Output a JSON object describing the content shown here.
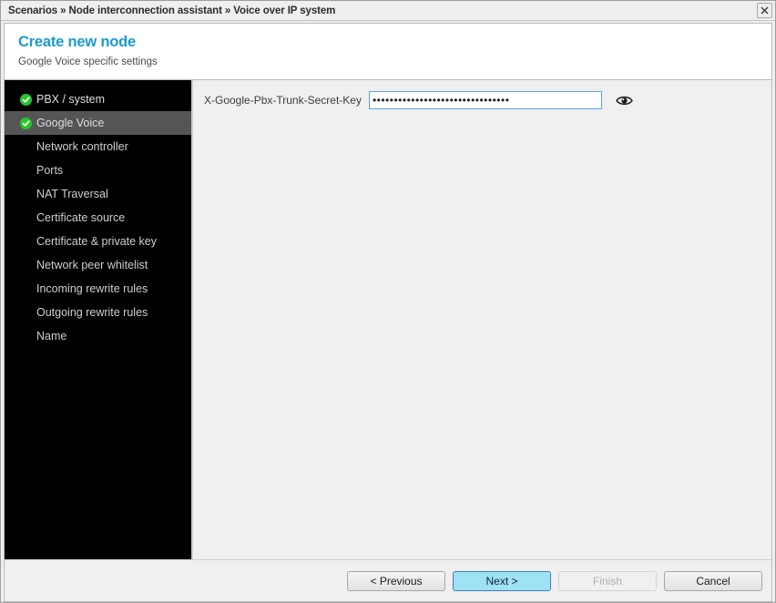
{
  "titlebar": {
    "breadcrumb": "Scenarios » Node interconnection assistant » Voice over IP system",
    "close_icon": "close-x-icon"
  },
  "header": {
    "title": "Create new node",
    "subtitle": "Google Voice specific settings",
    "title_color": "#1b9bd0"
  },
  "sidebar": {
    "background": "#000000",
    "selected_background": "#555555",
    "check_color": "#27c62b",
    "items": [
      {
        "label": "PBX / system",
        "state": "completed",
        "selected": false
      },
      {
        "label": "Google Voice",
        "state": "completed",
        "selected": true
      },
      {
        "label": "Network controller",
        "state": "pending",
        "selected": false
      },
      {
        "label": "Ports",
        "state": "pending",
        "selected": false
      },
      {
        "label": "NAT Traversal",
        "state": "pending",
        "selected": false
      },
      {
        "label": "Certificate source",
        "state": "pending",
        "selected": false
      },
      {
        "label": "Certificate & private key",
        "state": "pending",
        "selected": false
      },
      {
        "label": "Network peer whitelist",
        "state": "pending",
        "selected": false
      },
      {
        "label": "Incoming rewrite rules",
        "state": "pending",
        "selected": false
      },
      {
        "label": "Outgoing rewrite rules",
        "state": "pending",
        "selected": false
      },
      {
        "label": "Name",
        "state": "pending",
        "selected": false
      }
    ]
  },
  "content": {
    "field": {
      "label": "X-Google-Pbx-Trunk-Secret-Key",
      "type": "password",
      "value": "••••••••••••••••••••••••••••••••",
      "placeholder": "",
      "focused": true,
      "reveal_icon": "eye-icon"
    }
  },
  "footer": {
    "buttons": [
      {
        "label": "< Previous",
        "style": "normal",
        "disabled": false
      },
      {
        "label": "Next >",
        "style": "primary",
        "disabled": false
      },
      {
        "label": "Finish",
        "style": "disabled",
        "disabled": true
      },
      {
        "label": "Cancel",
        "style": "normal",
        "disabled": false
      }
    ]
  }
}
